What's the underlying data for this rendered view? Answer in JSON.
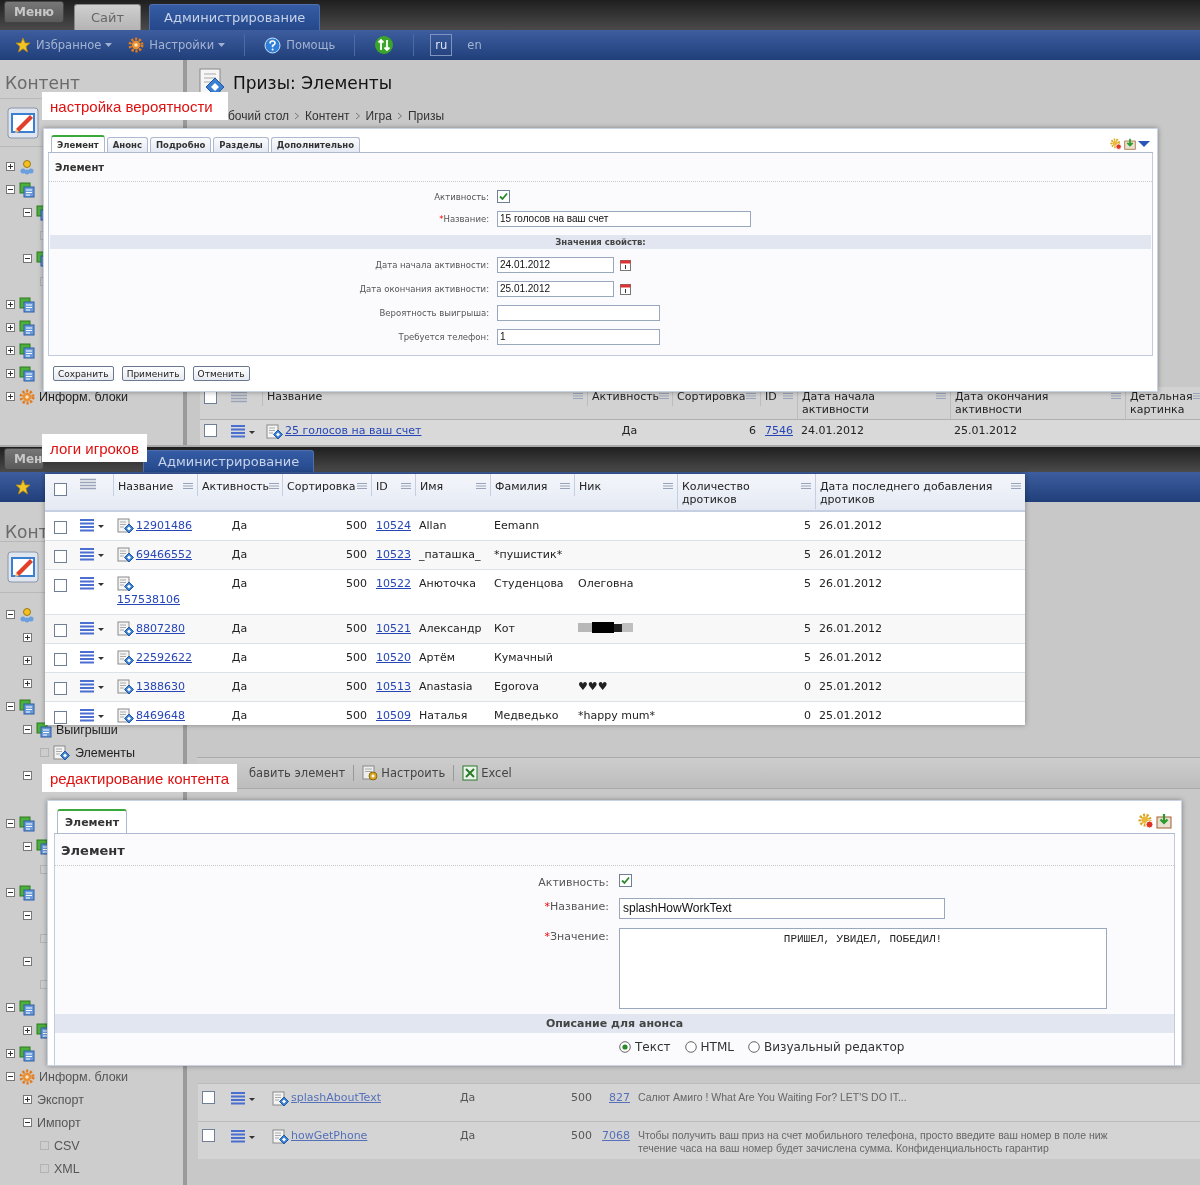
{
  "screens": [
    {
      "top_bar": {
        "menu": "Меню",
        "tabs": [
          {
            "label": "Сайт",
            "selected": false
          },
          {
            "label": "Администрирование",
            "selected": true
          }
        ]
      },
      "toolbar": [
        {
          "kind": "star",
          "label": "Избранное",
          "dropdown": true
        },
        {
          "kind": "gear",
          "label": "Настройки",
          "dropdown": true
        },
        {
          "kind": "help",
          "label": "Помощь",
          "dropdown": false
        },
        {
          "kind": "sync"
        },
        {
          "kind": "lang",
          "label": "ru",
          "selected": true
        },
        {
          "kind": "lang",
          "label": "en",
          "selected": false
        }
      ],
      "sidebar": {
        "title": "Контент",
        "tree": [
          {
            "kind": "people",
            "expanded": false
          },
          {
            "kind": "iblock",
            "expanded": true,
            "children": [
              {
                "kind": "iblock",
                "expanded": true,
                "children": [
                  {
                    "kind": "leaf"
                  }
                ]
              },
              {
                "kind": "iblock",
                "expanded": true,
                "children": [
                  {
                    "kind": "leaf"
                  }
                ]
              }
            ]
          },
          {
            "kind": "iblock",
            "expanded": false
          },
          {
            "kind": "iblock",
            "expanded": false
          },
          {
            "kind": "iblock",
            "expanded": false
          },
          {
            "kind": "iblock",
            "expanded": false
          },
          {
            "kind": "gear",
            "expanded": false,
            "label": "Информ. блоки"
          }
        ]
      },
      "main": {
        "title": "Призы: Элементы",
        "breadcrumb": [
          "бочий стол",
          "Контент",
          "Игра",
          "Призы"
        ],
        "table": {
          "all_checked": false,
          "columns": [
            {
              "label": "Название",
              "kind": "link-icon"
            },
            {
              "label": "Активность",
              "kind": "center"
            },
            {
              "label": "Сортировка",
              "kind": "num"
            },
            {
              "label": "ID",
              "kind": "link"
            },
            {
              "label": "Дата начала активности",
              "kind": "text"
            },
            {
              "label": "Дата окончания активности",
              "kind": "text"
            },
            {
              "label": "Детальная картинка",
              "kind": "text"
            }
          ],
          "rows": [
            {
              "checked": false,
              "cells": [
                "25 голосов на ваш счет",
                "Да",
                "6",
                "7546",
                "24.01.2012",
                "25.01.2012",
                null
              ]
            }
          ]
        }
      }
    },
    {
      "top_bar": {
        "menu": "Мен",
        "tabs": [
          {
            "label": "Администрирование",
            "selected": true
          }
        ]
      },
      "toolbar": [
        {
          "kind": "star"
        }
      ],
      "sidebar": {
        "title": "Конт",
        "tree": [
          {
            "kind": "people",
            "expanded": true,
            "children": [
              {
                "expanded": false
              },
              {
                "expanded": false
              },
              {
                "expanded": false
              }
            ]
          },
          {
            "kind": "iblock",
            "expanded": true,
            "children": [
              {
                "kind": "iblock",
                "expanded": true,
                "label": "Выигрыши",
                "children": [
                  {
                    "kind": "element",
                    "label": "Элементы"
                  }
                ]
              },
              {
                "expanded": true
              }
            ]
          }
        ]
      },
      "main": {
        "actions": [
          {
            "kind": "plain",
            "label": "бавить элемент"
          },
          {
            "kind": "settings",
            "label": "Настроить"
          },
          {
            "kind": "excel",
            "label": "Excel"
          }
        ]
      }
    },
    {
      "sidebar": {
        "tree": [
          {
            "kind": "iblock",
            "expanded": true,
            "children": [
              {
                "kind": "iblock",
                "expanded": true,
                "children": [
                  {
                    "kind": "leaf"
                  }
                ]
              }
            ]
          },
          {
            "kind": "iblock",
            "expanded": true,
            "children": [
              {
                "expanded": true,
                "children": [
                  {
                    "kind": "leaf"
                  }
                ]
              },
              {
                "expanded": true,
                "children": [
                  {
                    "kind": "leaf"
                  }
                ]
              }
            ]
          },
          {
            "kind": "iblock",
            "expanded": true,
            "children": [
              {
                "kind": "iblock",
                "expanded": false
              }
            ]
          },
          {
            "kind": "iblock",
            "expanded": false
          },
          {
            "kind": "gear",
            "expanded": true,
            "label": "Информ. блоки",
            "children": [
              {
                "expanded": false,
                "label": "Экспорт"
              },
              {
                "expanded": true,
                "label": "Импорт",
                "children": [
                  {
                    "kind": "leaf",
                    "label": "CSV"
                  },
                  {
                    "kind": "leaf",
                    "label": "XML"
                  }
                ]
              }
            ]
          }
        ]
      },
      "main": {
        "table": {
          "columns": [
            {
              "kind": "link-icon"
            },
            {
              "kind": "text"
            },
            {
              "kind": "num"
            },
            {
              "kind": "link"
            },
            {
              "kind": "text"
            }
          ],
          "rows": [
            {
              "checked": false,
              "cells": [
                "splashAboutText",
                "Да",
                "500",
                "827",
                [
                  "Салют Амиго ! What Are You Waiting For? LET'S DO IT..."
                ]
              ]
            },
            {
              "checked": false,
              "cells": [
                "howGetPhone",
                "Да",
                "500",
                "7068",
                [
                  "Чтобы получить ваш приз на счет мобильного телефона, просто введите ваш номер в поле ниж",
                  "течение часа на ваш номер будет зачислена сумма. Конфиденциальность гарантир"
                ]
              ]
            }
          ]
        }
      }
    }
  ],
  "overlays": [
    {
      "kind": "form",
      "caption": "настройка вероятности",
      "tabs": [
        {
          "label": "Элемент",
          "selected": true
        },
        {
          "label": "Анонс",
          "selected": false
        },
        {
          "label": "Подробно",
          "selected": false
        },
        {
          "label": "Разделы",
          "selected": false
        },
        {
          "label": "Дополнительно",
          "selected": false
        }
      ],
      "tools": [
        {
          "kind": "settings"
        },
        {
          "kind": "download"
        },
        {
          "kind": "caret"
        }
      ],
      "heading": "Элемент",
      "fields": [
        {
          "kind": "checkbox",
          "label": "Активность:",
          "checked": true
        },
        {
          "kind": "text",
          "label": "Название:",
          "required_mark": "*",
          "value": "15 голосов на ваш счет"
        },
        {
          "kind": "header",
          "label": "Значения свойств:"
        },
        {
          "kind": "date",
          "label": "Дата начала активности:",
          "value": "24.01.2012"
        },
        {
          "kind": "date",
          "label": "Дата окончания активности:",
          "value": "25.01.2012"
        },
        {
          "kind": "text",
          "label": "Вероятность выигрыша:"
        },
        {
          "kind": "text",
          "label": "Требуется телефон:",
          "value": "1"
        }
      ],
      "buttons": [
        "Сохранить",
        "Применить",
        "Отменить"
      ]
    },
    {
      "kind": "table",
      "caption": "логи игроков",
      "table": {
        "all_checked": false,
        "columns": [
          {
            "label": "Название",
            "kind": "link-icon"
          },
          {
            "label": "Активность",
            "kind": "center"
          },
          {
            "label": "Сортировка",
            "kind": "num"
          },
          {
            "label": "ID",
            "kind": "link"
          },
          {
            "label": "Имя",
            "kind": "text"
          },
          {
            "label": "Фамилия",
            "kind": "text"
          },
          {
            "label": "Ник",
            "kind": "text"
          },
          {
            "label": "Количество дротиков",
            "kind": "num"
          },
          {
            "label": "Дата последнего добавления дротиков",
            "kind": "text"
          }
        ],
        "rows": [
          {
            "checked": false,
            "cells": [
              "12901486",
              "Да",
              "500",
              "10524",
              "Allan",
              "Eemann",
              null,
              "5",
              "26.01.2012"
            ]
          },
          {
            "checked": false,
            "cells": [
              "69466552",
              "Да",
              "500",
              "10523",
              "_паташка_",
              "*пушистик*",
              null,
              "5",
              "26.01.2012"
            ]
          },
          {
            "checked": false,
            "cells": [
              "157538106",
              "Да",
              "500",
              "10522",
              "Анюточка",
              "Студенцова",
              "Олеговна",
              "5",
              "26.01.2012"
            ]
          },
          {
            "checked": false,
            "cells": [
              "8807280",
              "Да",
              "500",
              "10521",
              "Александр",
              "Кот",
              {
                "kind": "scribble"
              },
              "5",
              "26.01.2012"
            ]
          },
          {
            "checked": false,
            "cells": [
              "22592622",
              "Да",
              "500",
              "10520",
              "Артём",
              "Кумачный",
              null,
              "5",
              "26.01.2012"
            ]
          },
          {
            "checked": false,
            "cells": [
              "1388630",
              "Да",
              "500",
              "10513",
              "Anastasia",
              "Egorova",
              "♥♥♥",
              "0",
              "25.01.2012"
            ]
          },
          {
            "checked": false,
            "cells": [
              "8469648",
              "Да",
              "500",
              "10509",
              "Наталья",
              "Медведько",
              "*happy mum*",
              "0",
              "25.01.2012"
            ]
          }
        ]
      }
    },
    {
      "kind": "form",
      "caption": "редактирование контента",
      "tabs": [
        {
          "label": "Элемент",
          "selected": true
        }
      ],
      "tools": [
        {
          "kind": "settings"
        },
        {
          "kind": "download"
        }
      ],
      "heading": "Элемент",
      "fields": [
        {
          "kind": "checkbox",
          "label": "Активность:",
          "checked": true
        },
        {
          "kind": "text",
          "label": "Название:",
          "required_mark": "*",
          "value": "splashHowWorkText"
        },
        {
          "kind": "textarea",
          "label": "Значение:",
          "required_mark": "*",
          "value": "ПРИШЕЛ, УВИДЕЛ, ПОБЕДИЛ!"
        },
        {
          "kind": "header",
          "label": "Описание для анонса"
        },
        {
          "kind": "radios",
          "options": [
            {
              "label": "Текст",
              "selected": true
            },
            {
              "label": "HTML",
              "selected": false
            },
            {
              "label": "Визуальный редактор",
              "selected": false
            }
          ]
        }
      ]
    }
  ]
}
